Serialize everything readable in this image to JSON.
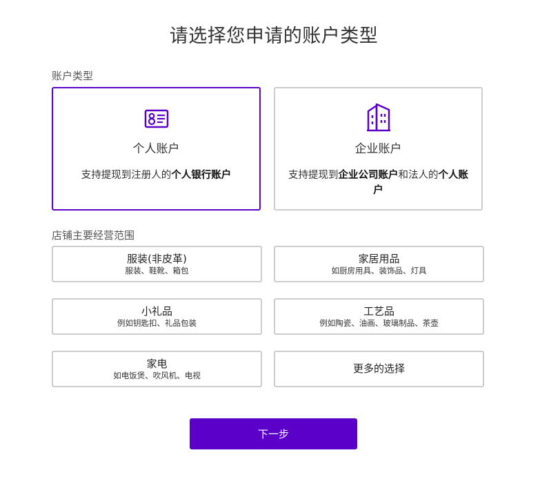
{
  "page": {
    "title": "请选择您申请的账户类型"
  },
  "account_section": {
    "label": "账户类型",
    "personal": {
      "icon": "id-card-icon",
      "name": "个人账户",
      "desc_prefix": "支持提现到注册人的",
      "desc_bold": "个人银行账户",
      "selected": true
    },
    "business": {
      "icon": "buildings-icon",
      "name": "企业账户",
      "desc_prefix": "支持提现到",
      "desc_bold1": "企业公司账户",
      "desc_middle": "和法人的",
      "desc_bold2": "个人账户",
      "selected": false
    }
  },
  "scope_section": {
    "label": "店铺主要经营范围",
    "items": [
      {
        "title": "服装(非皮革)",
        "subtitle": "服装、鞋靴、箱包"
      },
      {
        "title": "家居用品",
        "subtitle": "如厨房用具、装饰品、灯具"
      },
      {
        "title": "小礼品",
        "subtitle": "例如钥匙扣、礼品包装"
      },
      {
        "title": "工艺品",
        "subtitle": "例如陶瓷、油画、玻璃制品、茶壶"
      },
      {
        "title": "家电",
        "subtitle": "如电饭煲、吹风机、电视"
      },
      {
        "title": "更多的选择",
        "subtitle": ""
      }
    ]
  },
  "actions": {
    "next_label": "下一步"
  },
  "colors": {
    "accent": "#5a00c8",
    "border": "#cccccc",
    "text": "#333333"
  }
}
